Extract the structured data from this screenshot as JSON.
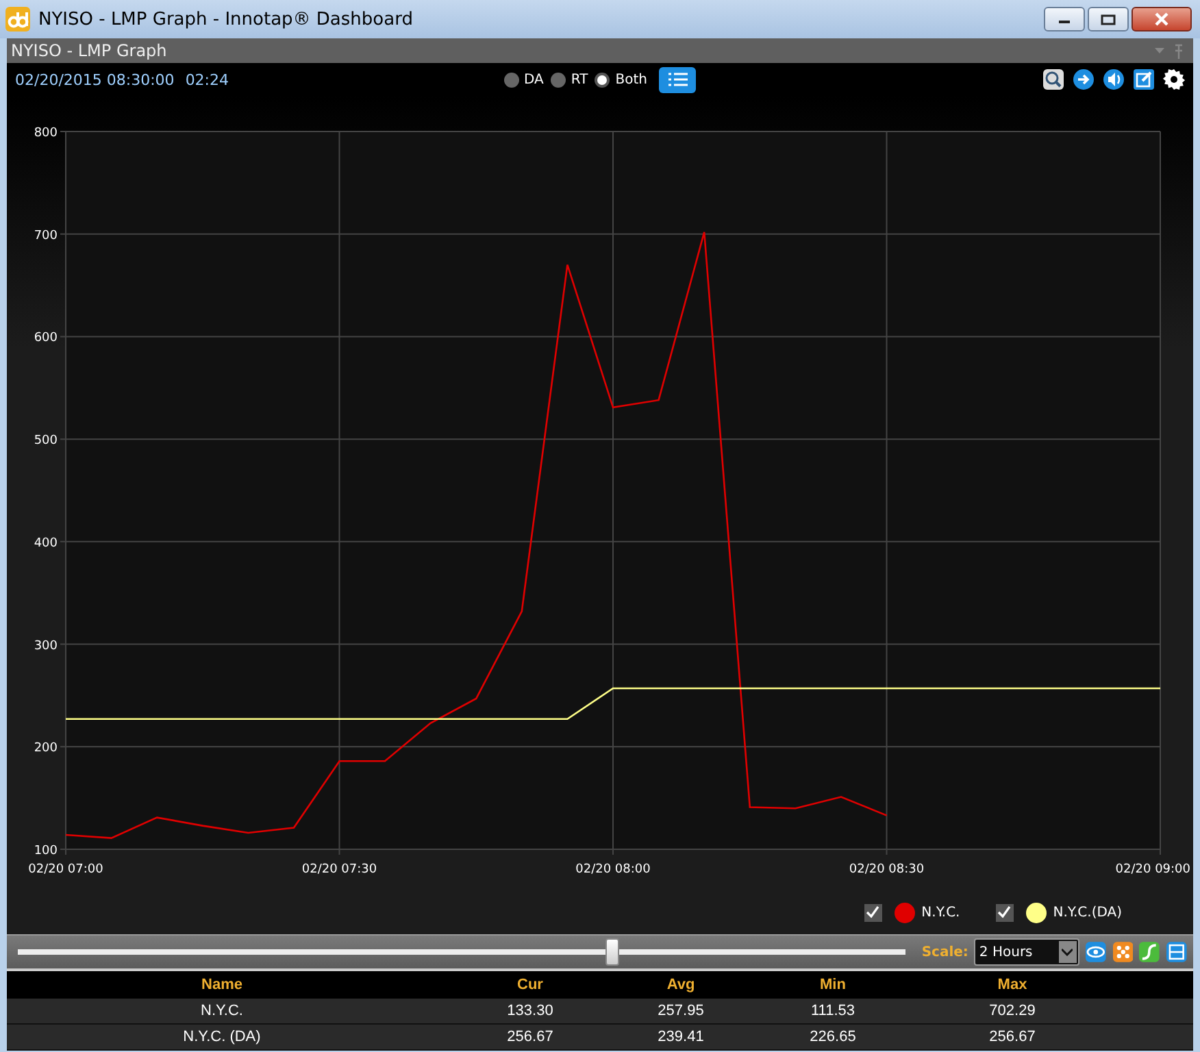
{
  "window": {
    "title": "NYISO - LMP Graph - Innotap® Dashboard"
  },
  "panel": {
    "title": "NYISO - LMP Graph"
  },
  "toolbar": {
    "timestamp": "02/20/2015 08:30:00",
    "countdown": "02:24",
    "modes": [
      {
        "label": "DA",
        "selected": false
      },
      {
        "label": "RT",
        "selected": false
      },
      {
        "label": "Both",
        "selected": true
      }
    ]
  },
  "chart": {
    "chart_data": {
      "type": "line",
      "grid": true,
      "categories": [
        "02/20 07:00",
        null,
        null,
        null,
        null,
        null,
        "02/20 07:30",
        null,
        null,
        null,
        null,
        null,
        "02/20 08:00",
        null,
        null,
        null,
        null,
        null,
        "02/20 08:30",
        null,
        null,
        null,
        null,
        null,
        "02/20 09:00"
      ],
      "series": [
        {
          "name": "N.Y.C.",
          "color": "#e00000",
          "values": [
            114,
            111,
            131,
            123,
            116,
            121,
            186,
            186,
            223,
            247,
            332,
            670,
            531,
            538,
            702,
            141,
            140,
            151,
            133,
            null,
            null,
            null,
            null,
            null,
            null
          ]
        },
        {
          "name": "N.Y.C.(DA)",
          "color": "#ffff88",
          "values": [
            227,
            227,
            227,
            227,
            227,
            227,
            227,
            227,
            227,
            227,
            227,
            227,
            257,
            257,
            257,
            257,
            257,
            257,
            257,
            257,
            257,
            257,
            257,
            257,
            257
          ]
        }
      ],
      "ylim": [
        100,
        800
      ],
      "yticks": [
        100,
        200,
        300,
        400,
        500,
        600,
        700,
        800
      ]
    }
  },
  "legend": [
    {
      "checked": true
    },
    {
      "checked": true
    }
  ],
  "slider": {
    "level": 0.67
  },
  "scale": {
    "label": "Scale:",
    "value": "2 Hours"
  },
  "table": {
    "columns": [
      "Name",
      "Cur",
      "Avg",
      "Min",
      "Max"
    ],
    "rows": [
      [
        "N.Y.C.",
        "133.30",
        "257.95",
        "111.53",
        "702.29"
      ],
      [
        "N.Y.C. (DA)",
        "256.67",
        "239.41",
        "226.65",
        "256.67"
      ]
    ]
  }
}
